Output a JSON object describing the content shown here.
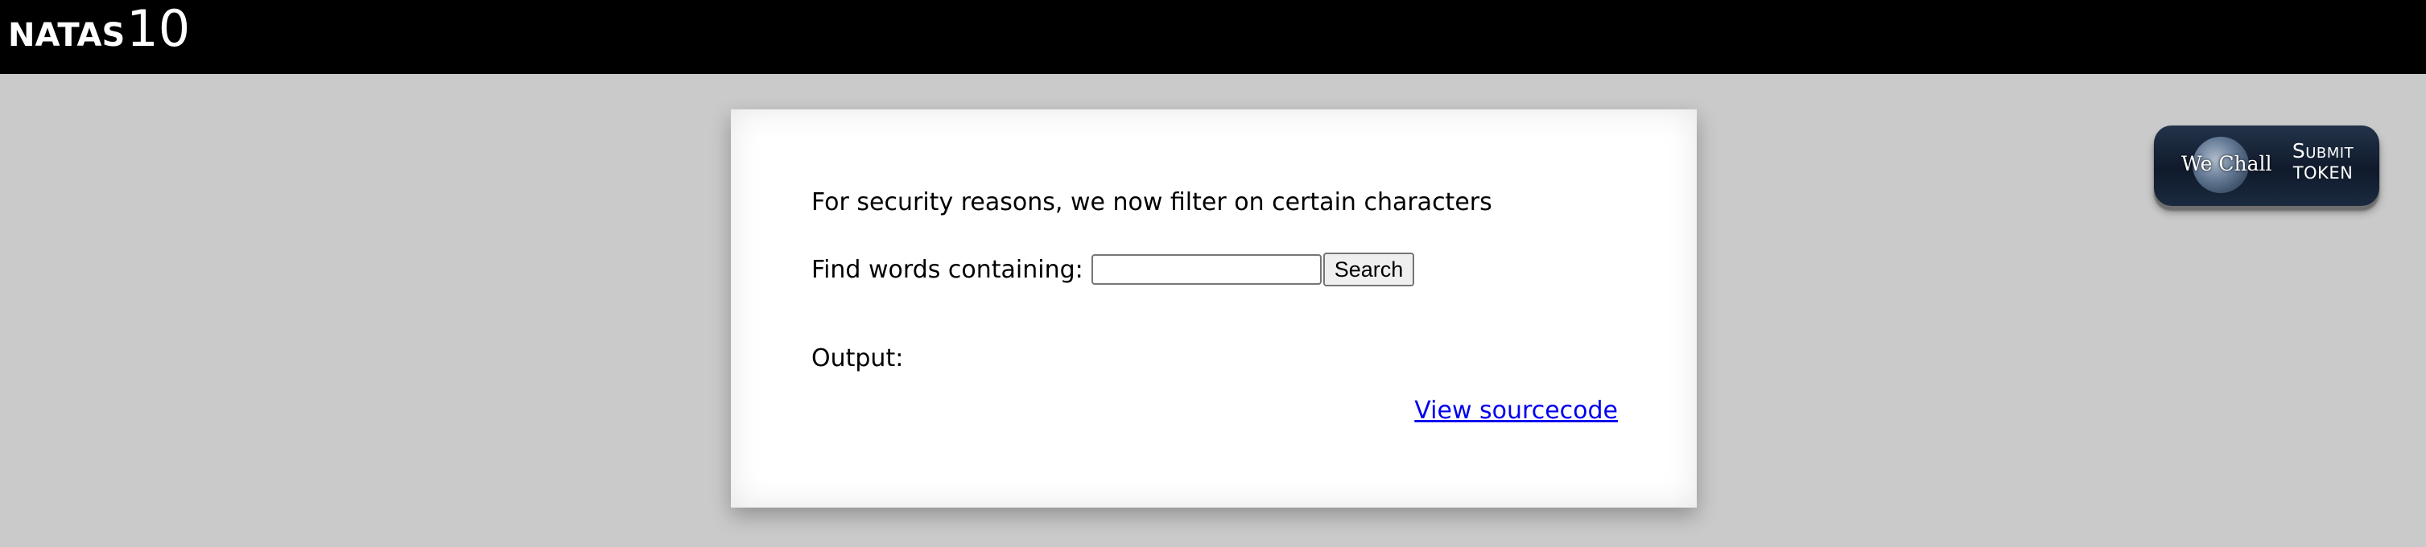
{
  "header": {
    "brand_name": "NATAS",
    "brand_level": "10"
  },
  "content": {
    "notice": "For security reasons, we now filter on certain characters",
    "search_label": "Find words containing:",
    "search_value": "",
    "search_button": "Search",
    "output_label": "Output:",
    "view_source_link": "View sourcecode"
  },
  "wechall": {
    "logo_text": "We Chall",
    "submit_line1": "Submit",
    "submit_line2": "token"
  },
  "colors": {
    "header_bg": "#000000",
    "page_bg": "#cacaca",
    "link": "#0000ee"
  }
}
